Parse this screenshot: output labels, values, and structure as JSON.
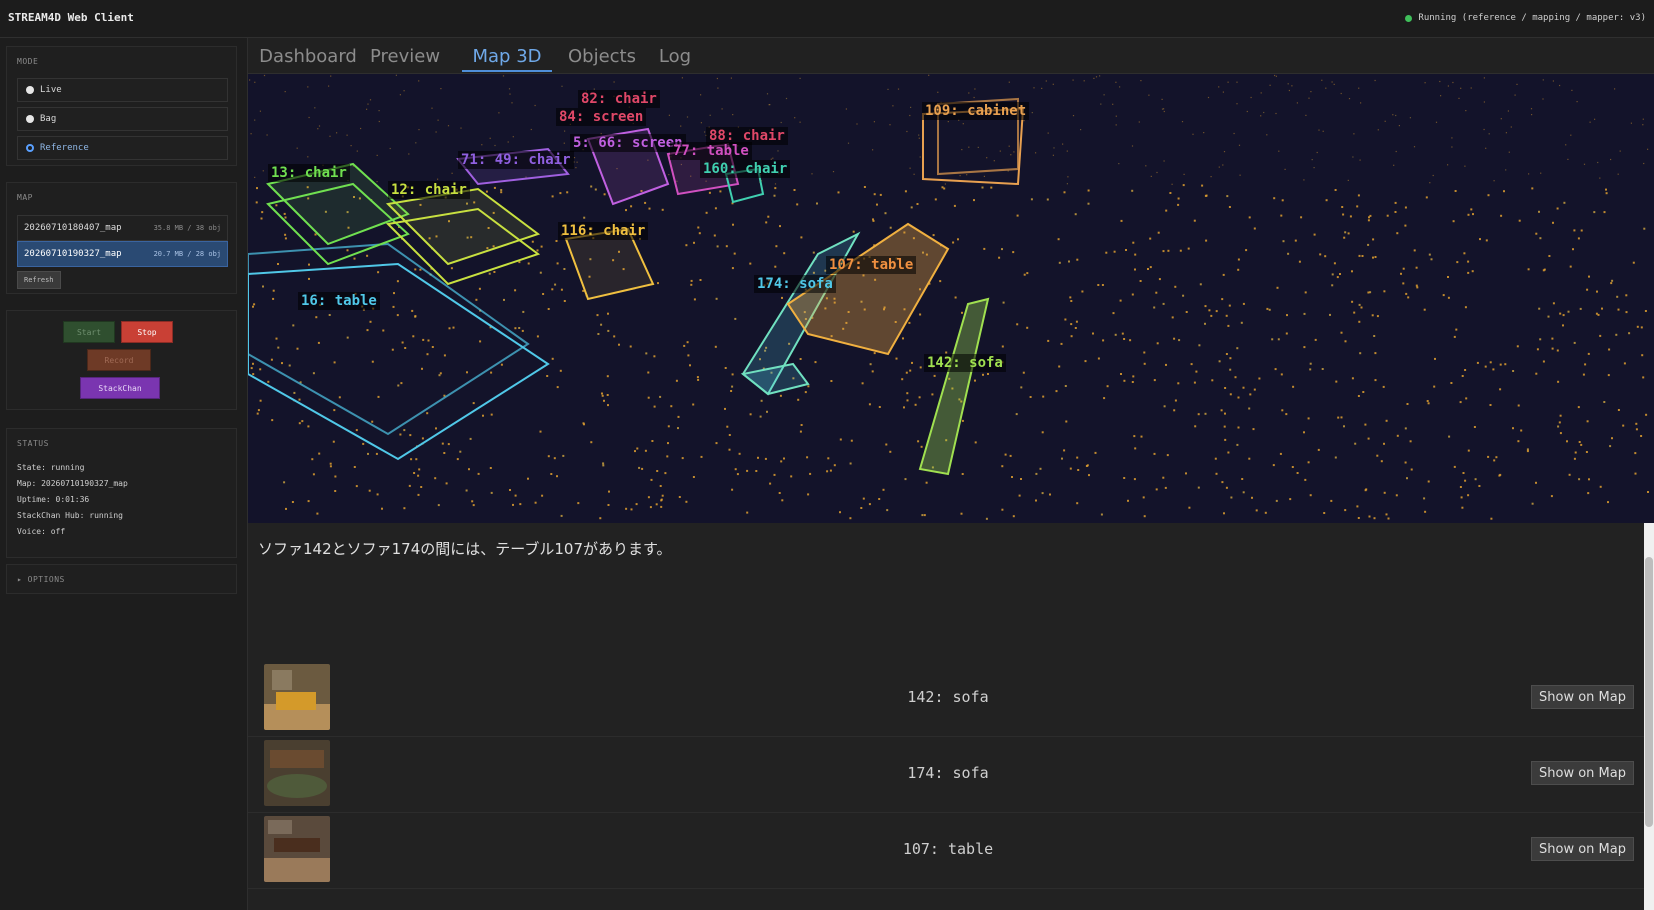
{
  "app": {
    "title": "STREAM4D Web Client",
    "status": "Running (reference / mapping / mapper: v3)",
    "status_color": "#3fbf5a"
  },
  "sidebar": {
    "mode": {
      "title": "MODE",
      "options": [
        "Live",
        "Bag",
        "Reference"
      ],
      "selected": "Reference"
    },
    "map": {
      "title": "MAP",
      "items": [
        {
          "name": "20260710180407_map",
          "meta": "35.8 MB / 38 obj"
        },
        {
          "name": "20260710190327_map",
          "meta": "20.7 MB / 28 obj"
        }
      ],
      "selected_index": 1,
      "refresh_label": "Refresh"
    },
    "controls": {
      "start": "Start",
      "stop": "Stop",
      "record": "Record",
      "stackchan": "StackChan"
    },
    "status": {
      "title": "STATUS",
      "lines": [
        "State: running",
        "Map: 20260710190327_map",
        "Uptime: 0:01:36",
        "StackChan Hub: running",
        "Voice: off"
      ]
    },
    "options_label": "▸ OPTIONS"
  },
  "tabs": {
    "items": [
      "Dashboard",
      "Preview",
      "Map 3D",
      "Objects",
      "Log"
    ],
    "active": "Map 3D"
  },
  "map3d": {
    "labels": [
      {
        "text": "82: chair",
        "color": "#e04868"
      },
      {
        "text": "84: screen",
        "color": "#e04868"
      },
      {
        "text": "109: cabinet",
        "color": "#e8a050"
      },
      {
        "text": "5: 66: screen",
        "color": "#c060e0"
      },
      {
        "text": "88: chair",
        "color": "#e04868"
      },
      {
        "text": "77: table",
        "color": "#d050c0"
      },
      {
        "text": "71: 49: chair",
        "color": "#9060e0"
      },
      {
        "text": "13: chair",
        "color": "#70e050"
      },
      {
        "text": "160: chair",
        "color": "#40d0b0"
      },
      {
        "text": "12: chair",
        "color": "#c8e040"
      },
      {
        "text": "116: chair",
        "color": "#f0c040"
      },
      {
        "text": "107: table",
        "color": "#f09040"
      },
      {
        "text": "174: sofa",
        "color": "#50c8e8"
      },
      {
        "text": "16: table",
        "color": "#50c8e8"
      },
      {
        "text": "142: sofa",
        "color": "#a0e050"
      }
    ]
  },
  "answer": "ソファ142とソファ174の間には、テーブル107があります。",
  "results": {
    "button_label": "Show on Map",
    "items": [
      {
        "label": "142: sofa",
        "thumb": "sofa-photo"
      },
      {
        "label": "174: sofa",
        "thumb": "sofa-photo"
      },
      {
        "label": "107: table",
        "thumb": "table-photo"
      }
    ]
  }
}
